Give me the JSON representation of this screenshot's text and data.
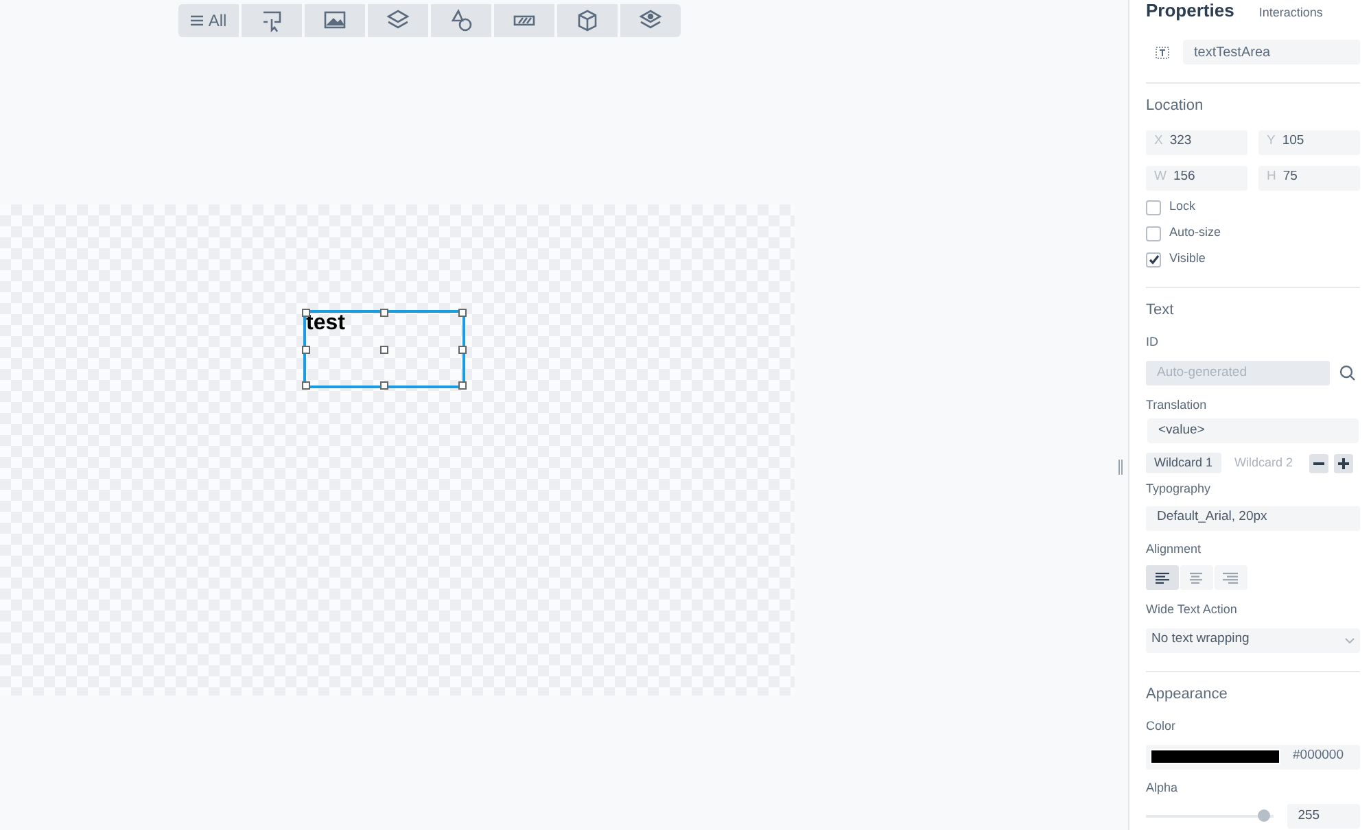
{
  "toolbar": {
    "all_label": "All"
  },
  "canvas": {
    "objects": [
      {
        "kind": "text",
        "text": "test",
        "selected": true
      }
    ]
  },
  "panel": {
    "tabs": [
      {
        "label": "Properties",
        "selected": true
      },
      {
        "label": "Interactions",
        "selected": false
      }
    ],
    "object_name": "textTestArea",
    "location": {
      "title": "Location",
      "fields": [
        {
          "label": "X",
          "value": "323"
        },
        {
          "label": "Y",
          "value": "105"
        },
        {
          "label": "W",
          "value": "156"
        },
        {
          "label": "H",
          "value": "75"
        }
      ],
      "checkboxes": [
        {
          "label": "Lock",
          "checked": false
        },
        {
          "label": "Auto-size",
          "checked": false
        },
        {
          "label": "Visible",
          "checked": true
        }
      ]
    },
    "text": {
      "title": "Text",
      "id_label": "ID",
      "id_placeholder": "Auto-generated",
      "translation_label": "Translation",
      "translation_value": "<value>",
      "wildcards": [
        {
          "label": "Wildcard 1",
          "selected": true
        },
        {
          "label": "Wildcard 2",
          "selected": false
        }
      ],
      "typography_label": "Typography",
      "typography_value": "Default_Arial, 20px",
      "alignment_label": "Alignment",
      "alignments": [
        {
          "kind": "left",
          "selected": true
        },
        {
          "kind": "center",
          "selected": false
        },
        {
          "kind": "right",
          "selected": false
        }
      ],
      "wide_label": "Wide Text Action",
      "wide_value": "No text wrapping"
    },
    "appearance": {
      "title": "Appearance",
      "color_label": "Color",
      "color": "#000000",
      "color_text": "#000000",
      "alpha_label": "Alpha",
      "alpha_slider": {
        "level": 0.93
      },
      "alpha_value": "255"
    }
  }
}
